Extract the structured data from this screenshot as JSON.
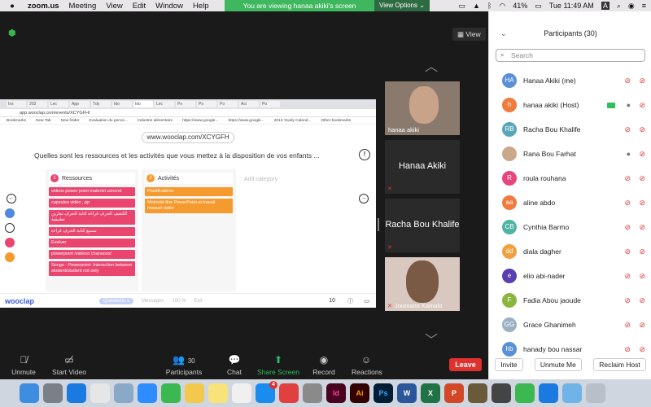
{
  "menubar": {
    "apple": "",
    "items": [
      "zoom.us",
      "Meeting",
      "View",
      "Edit",
      "Window",
      "Help"
    ],
    "battery": "41%",
    "clock": "Tue 11:49 AM",
    "input": "A"
  },
  "banner": {
    "viewing": "You are viewing hanaa akiki's screen",
    "view_options": "View Options ⌄"
  },
  "stage": {
    "view_label": "View"
  },
  "shared_screen": {
    "tabs": [
      "Ins",
      "203",
      "Lec",
      "App",
      "Tdy",
      "Ido",
      "Ido",
      "Lec",
      "Po",
      "Po",
      "Po",
      "Aci",
      "Po"
    ],
    "address": "app.wooclap.com/events/XCYGFH/",
    "bookmarks": [
      "Bookmarks",
      "New Tab",
      "New folder",
      "Evaluation du percei...",
      "Industrie alimentaire",
      "https://www.google...",
      "https://www.google...",
      "2013 Yearly Calend...",
      "Other bookmarks"
    ],
    "event_url": "www.wooclap.com/XCYGFH",
    "question": "Quelles sont les ressources et les activités que vous mettez à la disposition de vos enfants ...",
    "columns": [
      {
        "num": "1",
        "title": "Ressources",
        "color": "#e9456f",
        "cards": [
          "videos power point materiel concret",
          "capsules vidéo , pp",
          "الكشف الحرف قراءة كتابة الحرف تمارين تطبيقية",
          "تسمع كتابة الحرف قراءة",
          "Evaluer",
          "powerpoint /vidéos/ chansons/",
          "Songs - Powerpoint- Interaction between student/student not only"
        ]
      },
      {
        "num": "2",
        "title": "Activités",
        "color": "#f59a2e",
        "cards": [
          "Planifications",
          "Motricité fine PowerPoint  et travail manuel  vidéo"
        ]
      }
    ],
    "add_category": "Add category",
    "logo": "wooclap",
    "questions_label": "Questions",
    "questions_count": "1",
    "messages_label": "Messages",
    "zoom_level": "100 %",
    "exit_label": "Exit",
    "participants_count": "10"
  },
  "video_tiles": [
    {
      "name": "hanaa akiki",
      "type": "video"
    },
    {
      "name": "Hanaa Akiki",
      "type": "name"
    },
    {
      "name": "Racha Bou Khalife",
      "type": "name"
    },
    {
      "name": "Joumana Kamalo",
      "type": "video"
    }
  ],
  "toolbar": {
    "unmute": "Unmute",
    "start_video": "Start Video",
    "participants": "Participants",
    "participants_count": "30",
    "chat": "Chat",
    "share_screen": "Share Screen",
    "record": "Record",
    "reactions": "Reactions",
    "leave": "Leave"
  },
  "panel": {
    "title": "Participants (30)",
    "search_placeholder": "Search",
    "participants": [
      {
        "initials": "HA",
        "name": "Hanaa Akiki (me)",
        "color": "#5b8fd9"
      },
      {
        "initials": "h",
        "name": "hanaa akiki (Host)",
        "color": "#f07b3f"
      },
      {
        "initials": "RB",
        "name": "Racha Bou Khalife",
        "color": "#59a5b9"
      },
      {
        "initials": "",
        "name": "Rana Bou Farhat",
        "color": "#c9a98a"
      },
      {
        "initials": "R",
        "name": "roula rouhana",
        "color": "#e9457c"
      },
      {
        "initials": "aa",
        "name": "aline abdo",
        "color": "#f07b3f"
      },
      {
        "initials": "CB",
        "name": "Cynthia Barmo",
        "color": "#4fb3a4"
      },
      {
        "initials": "dd",
        "name": "diala dagher",
        "color": "#f0a03f"
      },
      {
        "initials": "e",
        "name": "elio abi-nader",
        "color": "#5a3fb0"
      },
      {
        "initials": "F",
        "name": "Fadia Abou jaoude",
        "color": "#8ab63f"
      },
      {
        "initials": "GG",
        "name": "Grace Ghanimeh",
        "color": "#9ab0c3"
      },
      {
        "initials": "hb",
        "name": "hanady bou nassar",
        "color": "#5b8fd9"
      }
    ],
    "invite": "Invite",
    "unmute_me": "Unmute Me",
    "reclaim_host": "Reclaim Host"
  },
  "dock": {
    "icons": [
      "finder",
      "launchpad",
      "safari",
      "chrome",
      "preview",
      "zoom",
      "facetime",
      "photos",
      "notes",
      "music",
      "app-store",
      "toolbox",
      "settings",
      "indesign",
      "illustrator",
      "photoshop",
      "word",
      "excel",
      "powerpoint",
      "game",
      "quicktime",
      "messages",
      "accessibility",
      "folder",
      "trash"
    ],
    "badge_count": "4",
    "labels": {
      "indesign": "Id",
      "illustrator": "Ai",
      "photoshop": "Ps",
      "word": "W",
      "excel": "X",
      "powerpoint": "P"
    }
  }
}
